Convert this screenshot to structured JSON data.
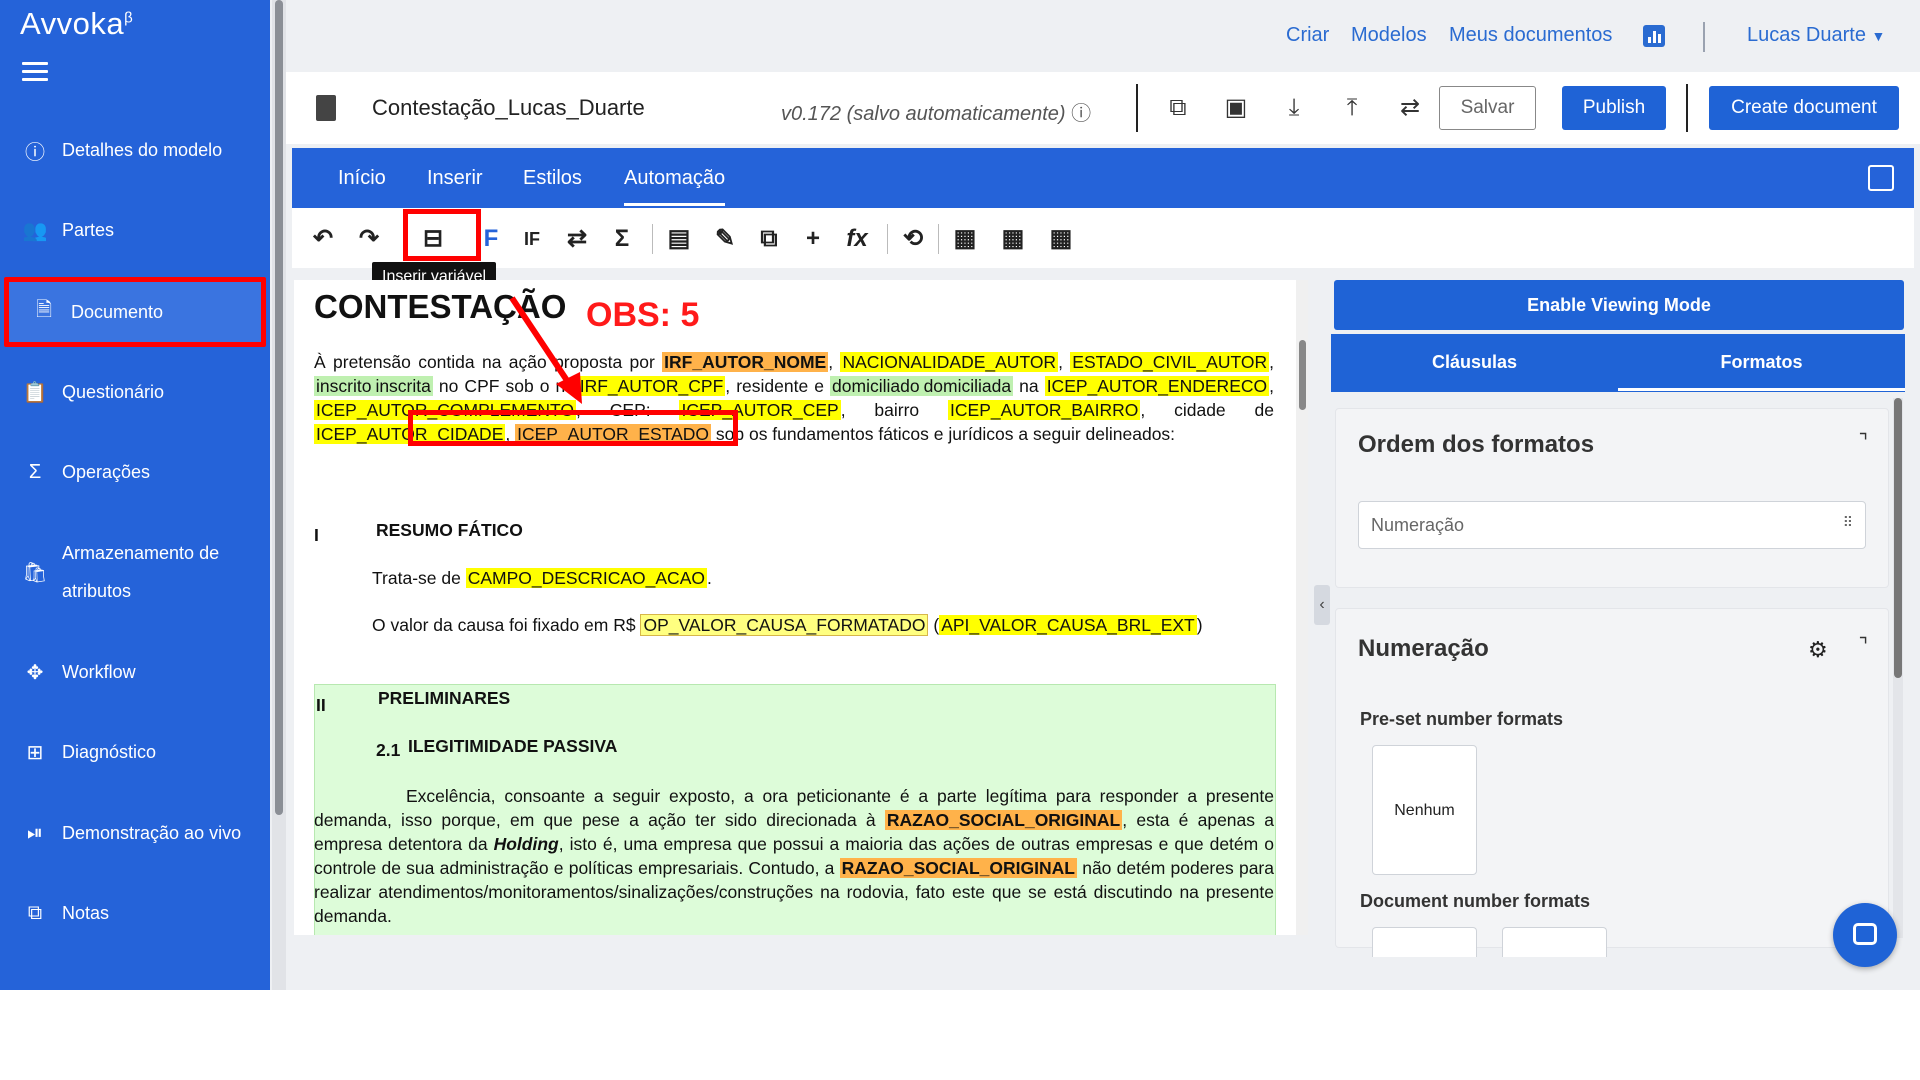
{
  "brand": {
    "name": "Avvoka",
    "mark": "β"
  },
  "sidebar": {
    "items": [
      {
        "label": "Detalhes do modelo",
        "icon": "info-icon"
      },
      {
        "label": "Partes",
        "icon": "users-icon"
      },
      {
        "label": "Documento",
        "icon": "document-icon"
      },
      {
        "label": "Questionário",
        "icon": "clipboard-icon"
      },
      {
        "label": "Operações",
        "icon": "sigma-icon"
      },
      {
        "label": "Armazenamento de atributos",
        "label_line1": "Armazenamento de",
        "label_line2": "atributos",
        "icon": "bag-icon"
      },
      {
        "label": "Workflow",
        "icon": "workflow-icon"
      },
      {
        "label": "Diagnóstico",
        "icon": "plus-square-icon"
      },
      {
        "label": "Demonstração ao vivo",
        "icon": "play-pause-icon"
      },
      {
        "label": "Notas",
        "icon": "copy-icon"
      }
    ]
  },
  "topnav": {
    "criar": "Criar",
    "modelos": "Modelos",
    "meus_documentos": "Meus documentos",
    "user": "Lucas Duarte"
  },
  "docbar": {
    "title": "Contestação_Lucas_Duarte",
    "version": "v0.172 (salvo automaticamente)",
    "salvar": "Salvar",
    "publish": "Publish",
    "create": "Create document"
  },
  "ribbon": {
    "tabs": [
      "Início",
      "Inserir",
      "Estilos",
      "Automação"
    ]
  },
  "tooltip": "Inserir variável",
  "annotation": "OBS: 5",
  "document": {
    "title": "CONTESTAÇÃO",
    "p1": {
      "t1": "À pretensão contida na ação proposta por ",
      "v1": "IRF_AUTOR_NOME",
      "s1": ", ",
      "v2": "NACIONALIDADE_AUTOR",
      "s2": ", ",
      "v3": "ESTADO_CIVIL_AUTOR",
      "s3": ",",
      "v4": "inscrito",
      "v5": "inscrita",
      "t2": " no CPF sob o nº ",
      "v6": "IRF_AUTOR_CPF",
      "t3": ", residente e ",
      "v7": "domiciliado",
      "v8": "domiciliada",
      "t4": " na ",
      "v9": "ICEP_AUTOR_ENDERECO",
      "s4": ", ",
      "v10": "ICEP_AUTOR_COMPLEMENTO",
      "t5": ", CEP: ",
      "v11": "ICEP_AUTOR_CEP",
      "t6": ", bairro ",
      "v12": "ICEP_AUTOR_BAIRRO",
      "t7": ", cidade de ",
      "v13": "ICEP_AUTOR_CIDADE",
      "s5": ", ",
      "v14": "ICEP_AUTOR_ESTADO",
      "t8": " sob os fundamentos fáticos e jurídicos a seguir delineados:"
    },
    "sec1": {
      "num": "I",
      "title": "RESUMO FÁTICO"
    },
    "p2": {
      "t1": "Trata-se de ",
      "v1": "CAMPO_DESCRICAO_ACAO",
      "t2": "."
    },
    "p3": {
      "t1": "O valor da causa foi fixado em R$ ",
      "v1": "OP_VALOR_CAUSA_FORMATADO",
      "t2": " (",
      "v2": "API_VALOR_CAUSA_BRL_EXT",
      "t3": ")"
    },
    "sec2": {
      "num": "II",
      "title": "PRELIMINARES"
    },
    "sec21": {
      "num": "2.1",
      "title": "ILEGITIMIDADE PASSIVA"
    },
    "p4": {
      "t1": "Excelência, consoante a seguir exposto, a ora peticionante é a parte legítima para responder a presente demanda, isso porque, em que pese a ação ter sido direcionada à ",
      "v1": "RAZAO_SOCIAL_ORIGINAL",
      "t2": ", esta é apenas a empresa detentora da ",
      "em": "Holding",
      "t3": ", isto é, uma empresa que possui a maioria das ações de outras empresas e que detém o controle de sua administração e políticas empresariais. Contudo, a ",
      "v2": "RAZAO_SOCIAL_ORIGINAL",
      "t4": " não detém poderes para realizar atendimentos/monitoramentos/sinalizações/construções na rodovia, fato este que se está discutindo na presente demanda."
    }
  },
  "rpanel": {
    "viewing": "Enable Viewing Mode",
    "tabs": [
      "Cláusulas",
      "Formatos"
    ],
    "ordem_title": "Ordem dos formatos",
    "ordem_field": "Numeração",
    "numeracao_title": "Numeração",
    "preset_label": "Pre-set number formats",
    "preset_card": "Nenhum",
    "docnum_label": "Document number formats"
  },
  "colors": {
    "primary": "#2563d9",
    "highlight_yellow": "#ffff00",
    "highlight_orange": "#ffb24a",
    "highlight_green": "#bff0b0",
    "annotation_red": "#ff0000"
  }
}
